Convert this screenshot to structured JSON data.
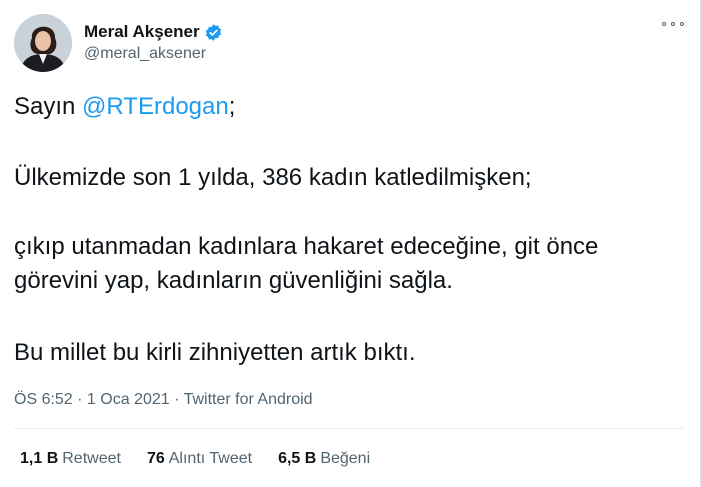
{
  "author": {
    "display_name": "Meral Akşener",
    "handle": "@meral_aksener",
    "verified": true,
    "avatar_icon": "avatar-photo"
  },
  "tweet": {
    "line1_prefix": "Sayın ",
    "line1_mention": "@RTErdogan",
    "line1_suffix": ";",
    "line2": "Ülkemizde son 1 yılda, 386 kadın katledilmişken;",
    "line3a": "çıkıp utanmadan kadınlara hakaret edeceğine, git önce",
    "line3b": "görevini yap, kadınların güvenliğini sağla.",
    "line4": "Bu millet bu kirli zihniyetten artık bıktı."
  },
  "meta": {
    "time": "ÖS 6:52",
    "separator": " · ",
    "date": "1 Oca 2021",
    "source": "Twitter for Android"
  },
  "stats": {
    "retweets_value": "1,1 B",
    "retweets_label": "Retweet",
    "quotes_value": "76",
    "quotes_label": "Alıntı Tweet",
    "likes_value": "6,5 B",
    "likes_label": "Beğeni"
  },
  "colors": {
    "link": "#1d9bf0",
    "secondary_text": "#536471",
    "verified_badge": "#1d9bf0"
  }
}
